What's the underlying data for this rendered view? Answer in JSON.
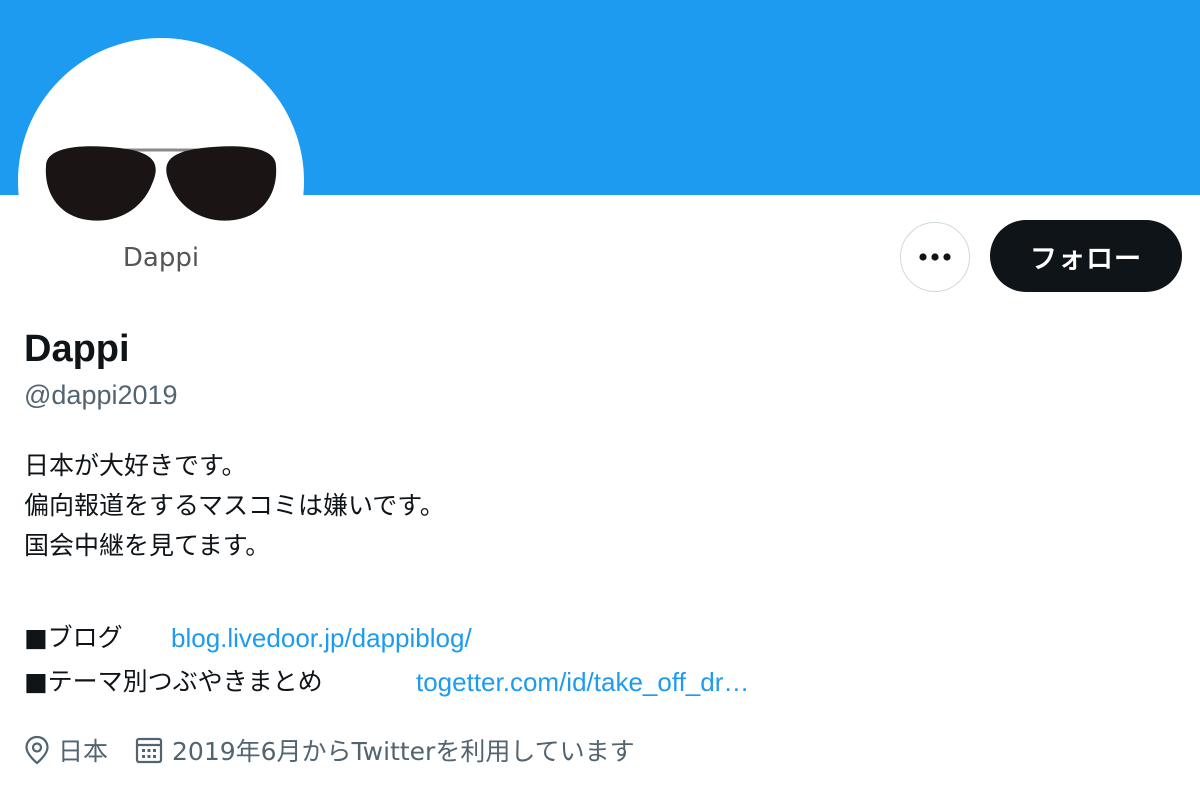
{
  "profile": {
    "display_name": "Dappi",
    "handle": "@dappi2019",
    "avatar_text": "Dappi",
    "bio": [
      "日本が大好きです。",
      "偏向報道をするマスコミは嫌いです。",
      "国会中継を見てます。"
    ],
    "links": [
      {
        "label": "■ブログ",
        "url": "blog.livedoor.jp/dappiblog/"
      },
      {
        "label": "■テーマ別つぶやきまとめ",
        "url": "togetter.com/id/take_off_dr…"
      }
    ],
    "location": "日本",
    "joined": "2019年6月からTwitterを利用しています"
  },
  "actions": {
    "more_label": "•••",
    "follow_label": "フォロー"
  },
  "icons": {
    "avatar": "sunglasses-icon",
    "more": "more-options-icon",
    "location": "location-pin-icon",
    "joined": "calendar-icon"
  },
  "colors": {
    "banner": "#1d9bf0",
    "link": "#1d9bf0",
    "follow_button": "#0f1419",
    "secondary_text": "#536471"
  }
}
